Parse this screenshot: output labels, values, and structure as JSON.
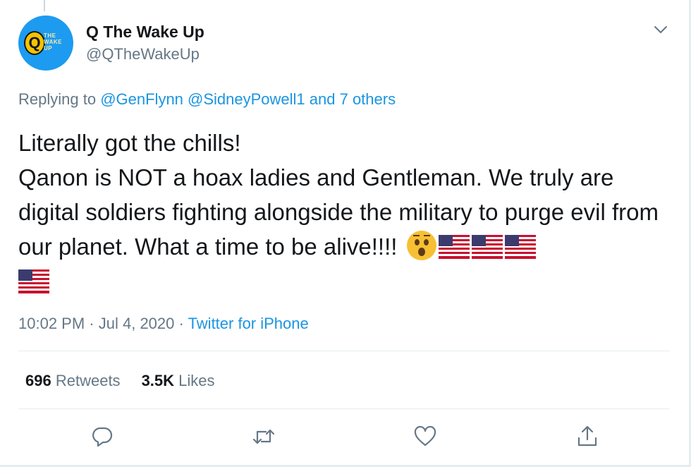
{
  "author": {
    "display_name": "Q The Wake Up",
    "handle": "@QTheWakeUp",
    "avatar_letter": "Q",
    "avatar_text": "THE WAKE UP"
  },
  "reply": {
    "prefix": "Replying to",
    "mentions": "@GenFlynn @SidneyPowell1 and 7 others"
  },
  "tweet": {
    "line1": "Literally got the chills!",
    "line2": "Qanon is NOT a hoax ladies and Gentleman. We truly are digital soldiers fighting alongside the military to purge evil from our planet. What a time to be alive!!!!"
  },
  "meta": {
    "time": "10:02 PM",
    "separator": "·",
    "date": "Jul 4, 2020",
    "source": "Twitter for iPhone"
  },
  "stats": {
    "retweets_count": "696",
    "retweets_label": "Retweets",
    "likes_count": "3.5K",
    "likes_label": "Likes"
  },
  "icons": {
    "more": "chevron-down-icon",
    "reply": "reply-icon",
    "retweet": "retweet-icon",
    "like": "heart-icon",
    "share": "share-icon"
  },
  "colors": {
    "link": "#1b95e0",
    "secondary_text": "#657786",
    "avatar_bg": "#1d9bf0"
  }
}
